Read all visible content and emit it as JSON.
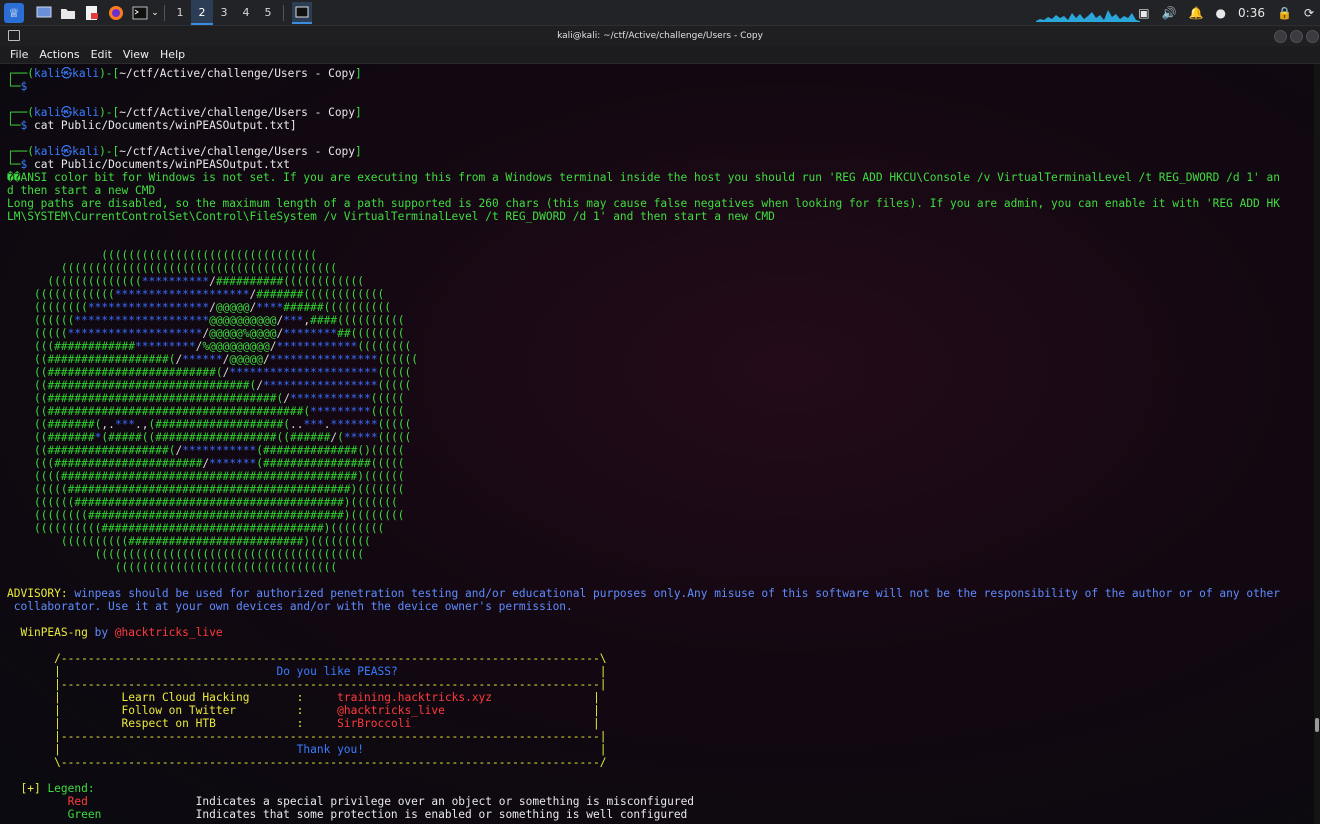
{
  "taskbar": {
    "workspaces": [
      "1",
      "2",
      "3",
      "4",
      "5"
    ],
    "active_workspace": "2",
    "clock": "0:36",
    "launcher_icons": [
      "kali-menu-icon",
      "desktop-icon",
      "folder-icon",
      "text-editor-icon",
      "firefox-icon",
      "terminal-icon"
    ]
  },
  "window": {
    "title": "kali@kali: ~/ctf/Active/challenge/Users - Copy"
  },
  "menu": [
    "File",
    "Actions",
    "Edit",
    "View",
    "Help"
  ],
  "terminal": {
    "prompts": [
      {
        "user": "kali",
        "host": "kali",
        "path": "~/ctf/Active/challenge/Users - Copy",
        "command": ""
      },
      {
        "user": "kali",
        "host": "kali",
        "path": "~/ctf/Active/challenge/Users - Copy",
        "command": "cat Public/Documents/winPEASOutput.txt]"
      },
      {
        "user": "kali",
        "host": "kali",
        "path": "~/ctf/Active/challenge/Users - Copy",
        "command": "cat Public/Documents/winPEASOutput.txt"
      }
    ],
    "warning_1_line_1": "��ANSI color bit for Windows is not set. If you are executing this from a Windows terminal inside the host you should run 'REG ADD HKCU\\Console /v VirtualTerminalLevel /t REG_DWORD /d 1' an",
    "warning_1_line_2": "d then start a new CMD",
    "warning_2_line_1": "Long paths are disabled, so the maximum length of a path supported is 260 chars (this may cause false negatives when looking for files). If you are admin, you can enable it with 'REG ADD HK",
    "warning_2_line_2": "LM\\SYSTEM\\CurrentControlSet\\Control\\FileSystem /v VirtualTerminalLevel /t REG_DWORD /d 1' and then start a new CMD",
    "ascii_art": [
      "              ((((((((((((((((((((((((((((((((",
      "        (((((((((((((((((((((((((((((((((((((((((",
      "      ((((((((((((((**********/##########((((((((((((",
      "    ((((((((((((********************/#######((((((((((((",
      "    ((((((((******************/@@@@@/****######((((((((((",
      "    ((((((********************@@@@@@@@@@/***,####((((((((((",
      "    (((((********************/@@@@@%@@@@/********##((((((((",
      "    (((############*********/%@@@@@@@@@/************((((((((",
      "    ((##################(/******/@@@@@/****************((((((",
      "    ((#########################(/**********************(((((",
      "    ((##############################(/*****************(((((",
      "    ((##################################(/************(((((",
      "    ((######################################(*********(((((",
      "    ((#######(,.***.,(###################(..***.*******(((((",
      "    ((#######*(#####((##################((######/(*****(((((",
      "    ((##################(/***********(##############()(((((",
      "    (((######################/*******(################(((((",
      "    ((((############################################)((((((",
      "    (((((##########################################)(((((((",
      "    ((((((########################################)(((((((",
      "    ((((((((######################################)((((((((",
      "    ((((((((((#################################)((((((((",
      "        ((((((((((##########################)(((((((((",
      "             ((((((((((((((((((((((((((((((((((((((((",
      "                ((((((((((((((((((((((((((((((((("
    ],
    "advisory_label": "ADVISORY:",
    "advisory_line_1": " winpeas should be used for authorized penetration testing and/or educational purposes only.Any misuse of this software will not be the responsibility of the author or of any other",
    "advisory_line_2": " collaborator. Use it at your own devices and/or with the device owner's permission.",
    "banner_name": "WinPEAS-ng",
    "banner_by": " by ",
    "banner_handle": "@hacktricks_live",
    "box": {
      "top": "/--------------------------------------------------------------------------------\\",
      "question": "Do you like PEASS?",
      "divider": "|--------------------------------------------------------------------------------|",
      "rows": [
        {
          "label": "Learn Cloud Hacking",
          "sep": ":",
          "value": "training.hacktricks.xyz"
        },
        {
          "label": "Follow on Twitter",
          "sep": ":",
          "value": "@hacktricks_live"
        },
        {
          "label": "Respect on HTB",
          "sep": ":",
          "value": "SirBroccoli"
        }
      ],
      "thanks": "Thank you!",
      "bottom": "\\--------------------------------------------------------------------------------/"
    },
    "legend_marker": "[+]",
    "legend_title": " Legend:",
    "legend": [
      {
        "name": "Red",
        "desc": "Indicates a special privilege over an object or something is misconfigured"
      },
      {
        "name": "Green",
        "desc": "Indicates that some protection is enabled or something is well configured"
      }
    ]
  }
}
